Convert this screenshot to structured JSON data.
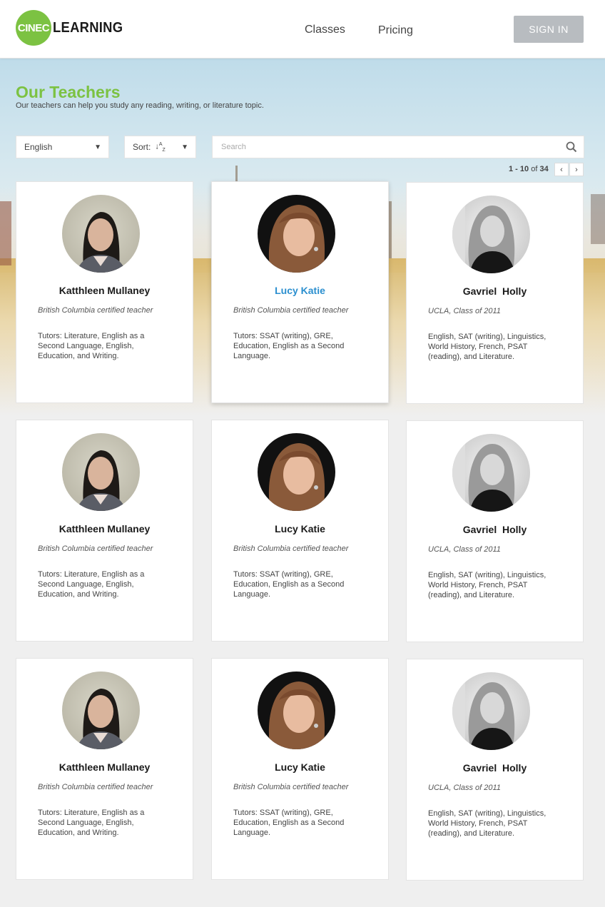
{
  "header": {
    "logo_mark": "CINEC",
    "logo_word": "LEARNING",
    "nav": [
      {
        "label": "Classes"
      },
      {
        "label": "Pricing"
      }
    ],
    "sign_in": "SIGN IN"
  },
  "page": {
    "title": "Our Teachers",
    "subtitle": "Our teachers can help you study any reading, writing, or literature topic."
  },
  "filters": {
    "language": "English",
    "sort_label": "Sort:",
    "sort_icon": "sort-alpha-icon",
    "search_placeholder": "Search"
  },
  "pagination": {
    "range": "1 - 10",
    "of": "of",
    "total": "34"
  },
  "colors": {
    "accent": "#7cc242",
    "link": "#2b8fcf",
    "button": "#b8bcc0"
  },
  "teachers": [
    {
      "name": "Katthleen Mullaney",
      "cred": "British Columbia certified teacher",
      "desc": "Tutors: Literature, English as a Second Language, English, Education, and Writing."
    },
    {
      "name": "Lucy Katie",
      "cred": "British Columbia certified teacher",
      "desc": "Tutors: SSAT (writing), GRE, Education, English as a Second Language."
    },
    {
      "name": "Gavriel  Holly",
      "cred": "UCLA, Class of 2011",
      "desc": "English, SAT (writing), Linguistics, World History, French, PSAT (reading), and Literature."
    },
    {
      "name": "Katthleen Mullaney",
      "cred": "British Columbia certified teacher",
      "desc": "Tutors: Literature, English as a Second Language, English, Education, and Writing."
    },
    {
      "name": "Lucy Katie",
      "cred": "British Columbia certified teacher",
      "desc": "Tutors: SSAT (writing), GRE, Education, English as a Second Language."
    },
    {
      "name": "Gavriel  Holly",
      "cred": "UCLA, Class of 2011",
      "desc": "English, SAT (writing), Linguistics, World History, French, PSAT (reading), and Literature."
    },
    {
      "name": "Katthleen Mullaney",
      "cred": "British Columbia certified teacher",
      "desc": "Tutors: Literature, English as a Second Language, English, Education, and Writing."
    },
    {
      "name": "Lucy Katie",
      "cred": "British Columbia certified teacher",
      "desc": "Tutors: SSAT (writing), GRE, Education, English as a Second Language."
    },
    {
      "name": "Gavriel  Holly",
      "cred": "UCLA, Class of 2011",
      "desc": "English, SAT (writing), Linguistics, World History, French, PSAT (reading), and Literature."
    }
  ]
}
